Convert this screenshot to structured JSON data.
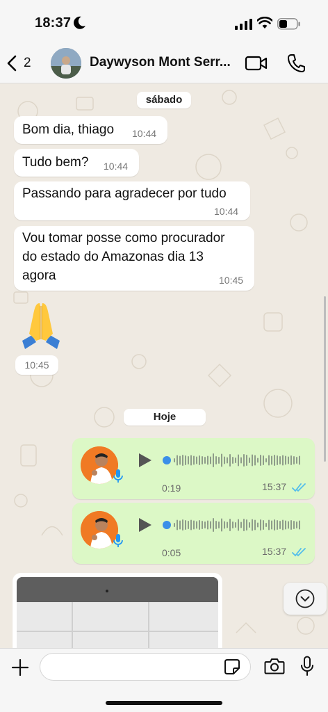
{
  "status_bar": {
    "time": "18:37",
    "icons": [
      "moon-icon",
      "cellular-signal-icon",
      "wifi-icon",
      "battery-icon"
    ]
  },
  "header": {
    "back_count": "2",
    "contact_name": "Daywyson Mont Serr...",
    "icons": [
      "chevron-left-icon",
      "video-camera-icon",
      "phone-icon"
    ]
  },
  "chat": {
    "background_color": "#efeae2",
    "date_separators": [
      "sábado",
      "Hoje"
    ],
    "incoming": [
      {
        "text": "Bom dia, thiago",
        "time": "10:44"
      },
      {
        "text": "Tudo bem?",
        "time": "10:44"
      },
      {
        "text": "Passando para agradecer por tudo",
        "time": "10:44"
      },
      {
        "text_lines": [
          "Vou tomar posse como procurador",
          "do estado do Amazonas dia 13",
          "agora"
        ],
        "time": "10:45"
      },
      {
        "emoji": "folded-hands-emoji",
        "time": "10:45"
      }
    ],
    "outgoing_audio": [
      {
        "duration": "0:19",
        "time": "15:37",
        "status": "read"
      },
      {
        "duration": "0:05",
        "time": "15:37",
        "status": "read"
      }
    ],
    "outgoing_bubble_color": "#dcf8c6",
    "read_tick_color": "#53bdeb"
  },
  "composer": {
    "input_value": "",
    "icons": [
      "plus-icon",
      "sticker-icon",
      "camera-icon",
      "microphone-icon"
    ]
  }
}
